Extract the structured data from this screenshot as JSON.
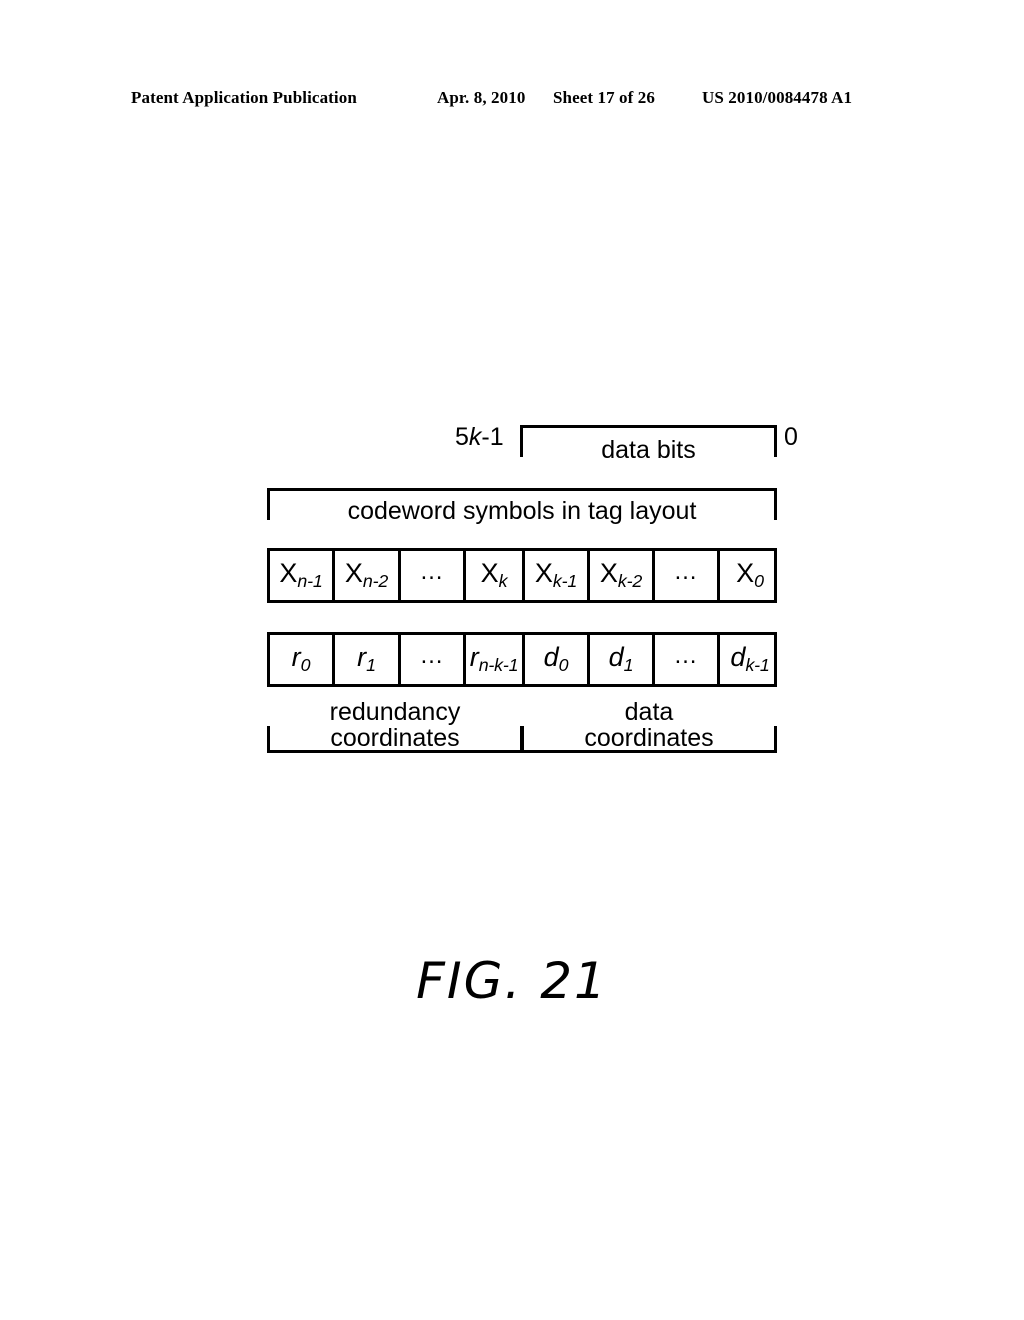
{
  "header": {
    "publication": "Patent Application Publication",
    "date": "Apr. 8, 2010",
    "sheet": "Sheet 17 of 26",
    "patent_number": "US 2010/0084478 A1"
  },
  "figure": {
    "caption": "FIG. 21",
    "top_bracket": {
      "left_label_prefix": "5",
      "left_label_italic": "k",
      "left_label_suffix": "-1",
      "left_label_plain": "5k-1",
      "label": "data bits",
      "right_label": "0"
    },
    "codeword_bracket": {
      "label": "codeword symbols in tag layout"
    },
    "symbol_row": {
      "cells": [
        {
          "base": "X",
          "base_italic": false,
          "sub": "n-1",
          "text": "Xn-1"
        },
        {
          "base": "X",
          "base_italic": false,
          "sub": "n-2",
          "text": "Xn-2"
        },
        {
          "base": "...",
          "base_italic": false,
          "sub": "",
          "text": "..."
        },
        {
          "base": "X",
          "base_italic": false,
          "sub": "k",
          "text": "Xk"
        },
        {
          "base": "X",
          "base_italic": false,
          "sub": "k-1",
          "text": "Xk-1"
        },
        {
          "base": "X",
          "base_italic": false,
          "sub": "k-2",
          "text": "Xk-2"
        },
        {
          "base": "...",
          "base_italic": false,
          "sub": "",
          "text": "..."
        },
        {
          "base": "X",
          "base_italic": false,
          "sub": "0",
          "text": "X0"
        }
      ]
    },
    "coordinate_row": {
      "cells": [
        {
          "base": "r",
          "base_italic": true,
          "sub": "0",
          "text": "r0"
        },
        {
          "base": "r",
          "base_italic": true,
          "sub": "1",
          "text": "r1"
        },
        {
          "base": "...",
          "base_italic": false,
          "sub": "",
          "text": "..."
        },
        {
          "base": "r",
          "base_italic": true,
          "sub": "n-k-1",
          "text": "rn-k-1"
        },
        {
          "base": "d",
          "base_italic": true,
          "sub": "0",
          "text": "d0"
        },
        {
          "base": "d",
          "base_italic": true,
          "sub": "1",
          "text": "d1"
        },
        {
          "base": "...",
          "base_italic": false,
          "sub": "",
          "text": "..."
        },
        {
          "base": "d",
          "base_italic": true,
          "sub": "k-1",
          "text": "dk-1"
        }
      ]
    },
    "bottom_brackets": [
      {
        "label_line1": "redundancy",
        "label_line2": "coordinates"
      },
      {
        "label_line1": "data",
        "label_line2": "coordinates"
      }
    ]
  },
  "colors": {
    "ink": "#000000",
    "page": "#ffffff"
  }
}
